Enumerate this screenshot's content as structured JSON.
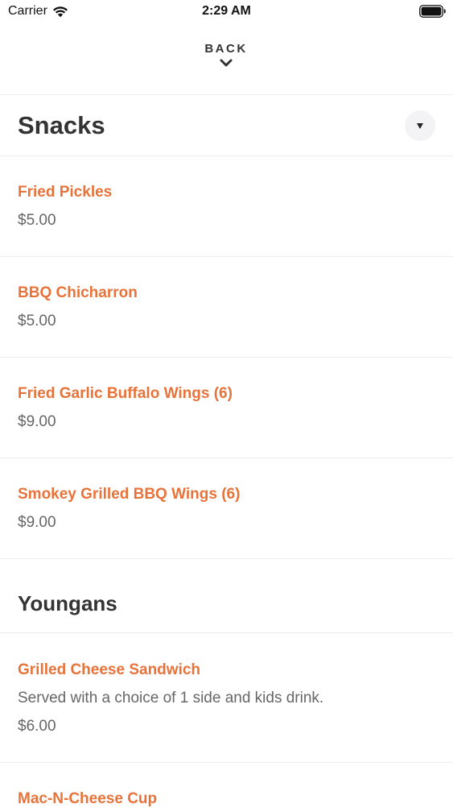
{
  "status_bar": {
    "carrier": "Carrier",
    "time": "2:29 AM",
    "wifi_icon": "wifi-icon",
    "battery_icon": "battery-full-icon"
  },
  "header": {
    "back_label": "BACK",
    "back_icon": "chevron-down-icon"
  },
  "sections": [
    {
      "title": "Snacks",
      "toggle_icon": "caret-down-icon",
      "items": [
        {
          "name": "Fried Pickles",
          "price": "$5.00"
        },
        {
          "name": "BBQ Chicharron",
          "price": "$5.00"
        },
        {
          "name": "Fried Garlic Buffalo Wings (6)",
          "price": "$9.00"
        },
        {
          "name": "Smokey Grilled BBQ Wings (6)",
          "price": "$9.00"
        }
      ]
    },
    {
      "title": "Youngans",
      "items": [
        {
          "name": "Grilled Cheese Sandwich",
          "description": "Served with a choice of 1 side and kids drink.",
          "price": "$6.00"
        },
        {
          "name": "Mac-N-Cheese Cup"
        }
      ]
    }
  ],
  "colors": {
    "accent": "#e8733a",
    "text": "#333333",
    "muted": "#666666",
    "divider": "#ececec"
  }
}
